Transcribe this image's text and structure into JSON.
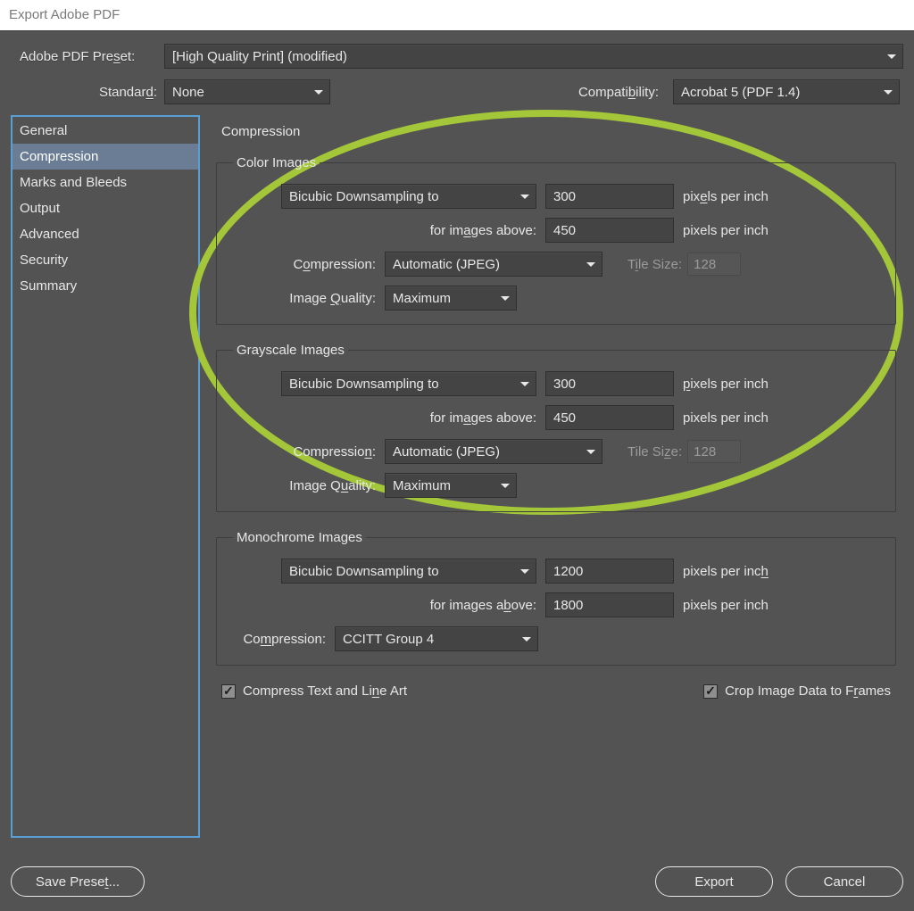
{
  "window": {
    "title": "Export Adobe PDF"
  },
  "header": {
    "preset_label": "Adobe PDF Preset:",
    "preset_value": "[High Quality Print] (modified)",
    "standard_label": "Standard:",
    "standard_value": "None",
    "compat_label": "Compatibility:",
    "compat_value": "Acrobat 5 (PDF 1.4)"
  },
  "sidebar": {
    "items": [
      "General",
      "Compression",
      "Marks and Bleeds",
      "Output",
      "Advanced",
      "Security",
      "Summary"
    ],
    "selected_index": 1
  },
  "panel": {
    "title": "Compression",
    "color": {
      "legend": "Color Images",
      "downsample_method": "Bicubic Downsampling to",
      "target": "300",
      "ppi1": "pixels per inch",
      "above_label": "for images above:",
      "above": "450",
      "ppi2": "pixels per inch",
      "comp_label": "Compression:",
      "comp_value": "Automatic (JPEG)",
      "tile_label": "Tile Size:",
      "tile_value": "128",
      "quality_label": "Image Quality:",
      "quality_value": "Maximum"
    },
    "gray": {
      "legend": "Grayscale Images",
      "downsample_method": "Bicubic Downsampling to",
      "target": "300",
      "ppi1": "pixels per inch",
      "above_label": "for images above:",
      "above": "450",
      "ppi2": "pixels per inch",
      "comp_label": "Compression:",
      "comp_value": "Automatic (JPEG)",
      "tile_label": "Tile Size:",
      "tile_value": "128",
      "quality_label": "Image Quality:",
      "quality_value": "Maximum"
    },
    "mono": {
      "legend": "Monochrome Images",
      "downsample_method": "Bicubic Downsampling to",
      "target": "1200",
      "ppi1": "pixels per inch",
      "above_label": "for images above:",
      "above": "1800",
      "ppi2": "pixels per inch",
      "comp_label": "Compression:",
      "comp_value": "CCITT Group 4"
    },
    "opts": {
      "compress_text_label": "Compress Text and Line Art",
      "compress_text_checked": true,
      "crop_label": "Crop Image Data to Frames",
      "crop_checked": true
    }
  },
  "footer": {
    "save_preset": "Save Preset...",
    "export": "Export",
    "cancel": "Cancel"
  },
  "annotation": {
    "highlight_color": "#a4c639"
  }
}
